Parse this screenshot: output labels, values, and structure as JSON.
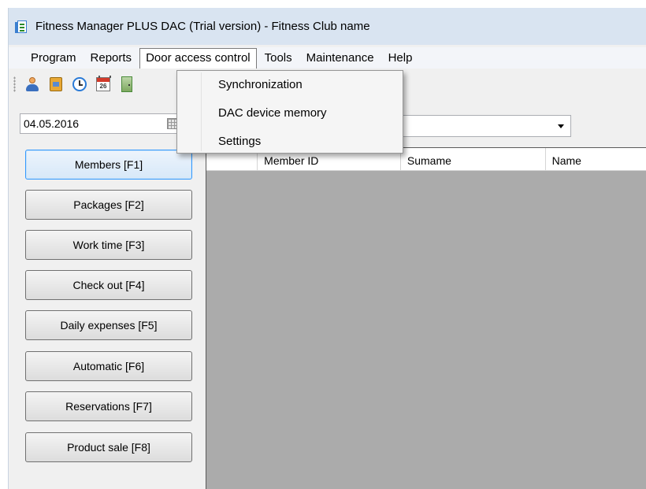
{
  "window": {
    "title": "Fitness Manager PLUS DAC (Trial version) - Fitness Club name"
  },
  "menubar": {
    "items": [
      {
        "label": "Program"
      },
      {
        "label": "Reports"
      },
      {
        "label": "Door access control",
        "active": true
      },
      {
        "label": "Tools"
      },
      {
        "label": "Maintenance"
      },
      {
        "label": "Help"
      }
    ]
  },
  "toolbar": {
    "icons": [
      "person-icon",
      "book-icon",
      "clock-icon",
      "calendar-icon",
      "door-icon"
    ],
    "calendar_icon_text": "26"
  },
  "dropdown": {
    "items": [
      {
        "label": "Synchronization"
      },
      {
        "label": "DAC device memory"
      },
      {
        "label": "Settings"
      }
    ]
  },
  "date_field": {
    "value": "04.05.2016"
  },
  "nav_buttons": [
    {
      "label": "Members  [F1]",
      "selected": true
    },
    {
      "label": "Packages  [F2]"
    },
    {
      "label": "Work time [F3]"
    },
    {
      "label": "Check out [F4]"
    },
    {
      "label": "Daily expenses [F5]"
    },
    {
      "label": "Automatic [F6]"
    },
    {
      "label": "Reservations [F7]"
    },
    {
      "label": "Product sale [F8]"
    }
  ],
  "grid": {
    "columns": [
      "Member ID",
      "Sumame",
      "Name"
    ]
  },
  "colors": {
    "title_bar": "#d9e4f1",
    "selected_border": "#3399ff",
    "grid_background": "#ababab"
  }
}
